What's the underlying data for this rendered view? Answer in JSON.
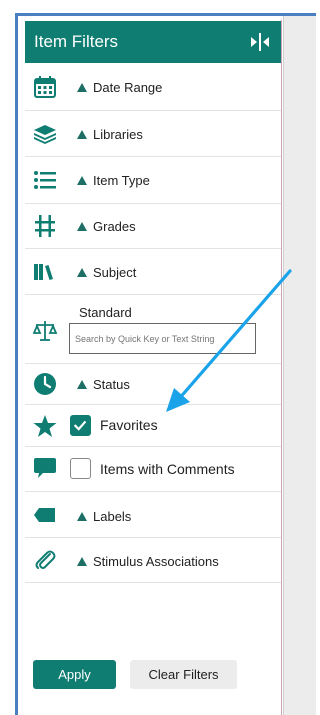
{
  "panel": {
    "title": "Item Filters",
    "collapse_icon": "collapse-panel-icon"
  },
  "filters": {
    "date_range": {
      "label": "Date Range",
      "icon": "calendar-icon"
    },
    "libraries": {
      "label": "Libraries",
      "icon": "stacked-books-icon"
    },
    "item_type": {
      "label": "Item Type",
      "icon": "list-icon"
    },
    "grades": {
      "label": "Grades",
      "icon": "grid-icon"
    },
    "subject": {
      "label": "Subject",
      "icon": "bookshelf-icon"
    },
    "standard": {
      "label": "Standard",
      "icon": "scales-icon",
      "placeholder": "Search by Quick Key or Text String"
    },
    "status": {
      "label": "Status",
      "icon": "clock-icon"
    },
    "favorites": {
      "label": "Favorites",
      "icon": "star-icon",
      "checked": true
    },
    "comments": {
      "label": "Items with Comments",
      "icon": "speech-bubble-icon",
      "checked": false
    },
    "labels": {
      "label": "Labels",
      "icon": "tag-icon"
    },
    "stimulus": {
      "label": "Stimulus Associations",
      "icon": "paperclip-icon"
    }
  },
  "actions": {
    "apply": "Apply",
    "clear": "Clear Filters"
  },
  "colors": {
    "accent": "#0f7d72",
    "annotation_arrow": "#1aa3e8"
  }
}
